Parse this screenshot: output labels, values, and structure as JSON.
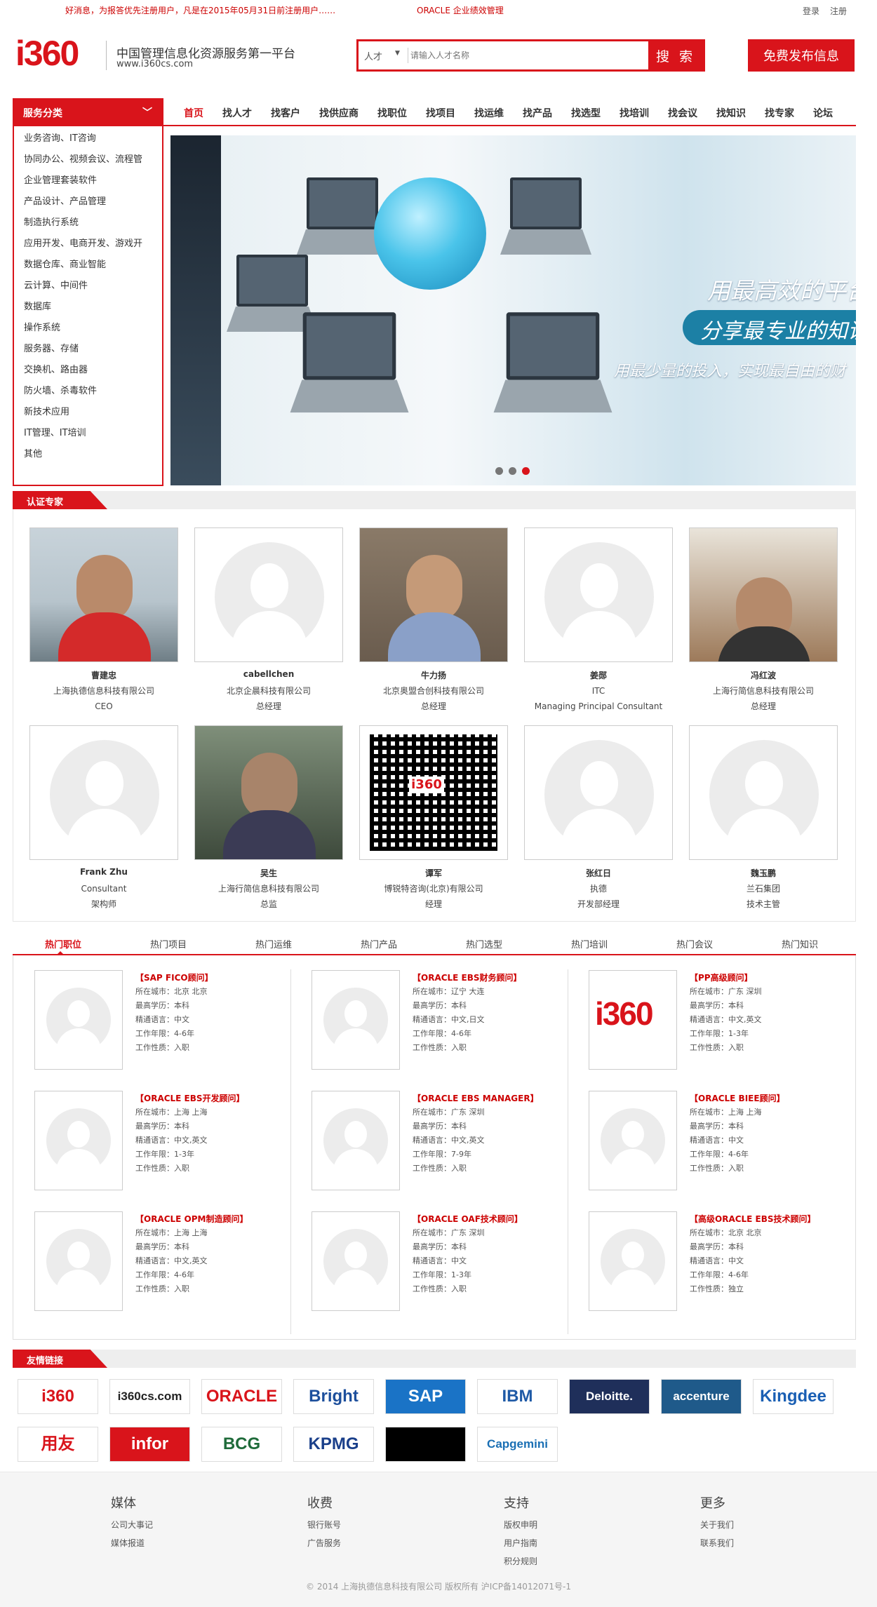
{
  "topbar": {
    "notice": "好消息，为报答优先注册用户，凡是在2015年05月31日前注册用户……",
    "headline": "ORACLE 企业绩效管理",
    "login": "登录",
    "register": "注册"
  },
  "header": {
    "logo": "i360",
    "slogan": "中国管理信息化资源服务第一平台",
    "url": "www.i360cs.com",
    "search": {
      "category": "人才",
      "placeholder": "请输入人才名称",
      "button": "搜 索"
    },
    "publish_button": "免费发布信息"
  },
  "service": {
    "title": "服务分类",
    "items": [
      "业务咨询、IT咨询",
      "协同办公、视频会议、流程管",
      "企业管理套装软件",
      "产品设计、产品管理",
      "制造执行系统",
      "应用开发、电商开发、游戏开",
      "数据仓库、商业智能",
      "云计算、中间件",
      "数据库",
      "操作系统",
      "服务器、存储",
      "交换机、路由器",
      "防火墙、杀毒软件",
      "新技术应用",
      "IT管理、IT培训",
      "其他"
    ]
  },
  "nav": [
    "首页",
    "找人才",
    "找客户",
    "找供应商",
    "找职位",
    "找项目",
    "找运维",
    "找产品",
    "找选型",
    "找培训",
    "找会议",
    "找知识",
    "找专家",
    "论坛"
  ],
  "banner": {
    "line1": "用最高效的平台",
    "line2": "分享最专业的知识",
    "line3": "用最少量的投入，实现最自由的财",
    "active_slide": 3,
    "slide_count": 3
  },
  "experts": {
    "title": "认证专家",
    "items": [
      {
        "name": "曹建忠",
        "company": "上海执德信息科技有限公司",
        "title": "CEO",
        "photo": "real"
      },
      {
        "name": "cabellchen",
        "company": "北京企晨科技有限公司",
        "title": "总经理",
        "photo": "placeholder"
      },
      {
        "name": "牛力扬",
        "company": "北京奥盟合创科技有限公司",
        "title": "总经理",
        "photo": "real"
      },
      {
        "name": "姜郧",
        "company": "ITC",
        "title": "Managing Principal Consultant",
        "photo": "placeholder"
      },
      {
        "name": "冯红波",
        "company": "上海行简信息科技有限公司",
        "title": "总经理",
        "photo": "real"
      },
      {
        "name": "Frank Zhu",
        "company": "Consultant",
        "title": "架构师",
        "photo": "placeholder"
      },
      {
        "name": "吴生",
        "company": "上海行简信息科技有限公司",
        "title": "总监",
        "photo": "real"
      },
      {
        "name": "谭军",
        "company": "博锐特咨询(北京)有限公司",
        "title": "经理",
        "photo": "qr"
      },
      {
        "name": "张红日",
        "company": "执德",
        "title": "开发部经理",
        "photo": "placeholder"
      },
      {
        "name": "魏玉鹏",
        "company": "兰石集团",
        "title": "技术主管",
        "photo": "placeholder"
      }
    ]
  },
  "tabs": [
    "热门职位",
    "热门项目",
    "热门运维",
    "热门产品",
    "热门选型",
    "热门培训",
    "热门会议",
    "热门知识"
  ],
  "job_labels": {
    "city": "所在城市：",
    "education": "最高学历：",
    "language": "精通语言：",
    "years": "工作年限：",
    "nature": "工作性质："
  },
  "jobs": [
    {
      "title": "【SAP FICO顾问】",
      "city": "北京 北京",
      "education": "本科",
      "language": "中文",
      "years": "4-6年",
      "nature": "入职"
    },
    {
      "title": "【ORACLE EBS财务顾问】",
      "city": "辽宁 大连",
      "education": "本科",
      "language": "中文,日文",
      "years": "4-6年",
      "nature": "入职"
    },
    {
      "title": "【PP高级顾问】",
      "city": "广东 深圳",
      "education": "本科",
      "language": "中文,英文",
      "years": "1-3年",
      "nature": "入职",
      "logo": "i360"
    },
    {
      "title": "【ORACLE EBS开发顾问】",
      "city": "上海 上海",
      "education": "本科",
      "language": "中文,英文",
      "years": "1-3年",
      "nature": "入职"
    },
    {
      "title": "【ORACLE EBS MANAGER】",
      "city": "广东 深圳",
      "education": "本科",
      "language": "中文,英文",
      "years": "7-9年",
      "nature": "入职"
    },
    {
      "title": "【ORACLE BIEE顾问】",
      "city": "上海 上海",
      "education": "本科",
      "language": "中文",
      "years": "4-6年",
      "nature": "入职"
    },
    {
      "title": "【ORACLE OPM制造顾问】",
      "city": "上海 上海",
      "education": "本科",
      "language": "中文,英文",
      "years": "4-6年",
      "nature": "入职"
    },
    {
      "title": "【ORACLE OAF技术顾问】",
      "city": "广东 深圳",
      "education": "本科",
      "language": "中文",
      "years": "1-3年",
      "nature": "入职"
    },
    {
      "title": "【高级ORACLE EBS技术顾问】",
      "city": "北京 北京",
      "education": "本科",
      "language": "中文",
      "years": "4-6年",
      "nature": "独立"
    }
  ],
  "links": {
    "title": "友情链接",
    "logos": [
      {
        "text": "i360",
        "color": "#d9141b",
        "bg": "#ffffff"
      },
      {
        "text": "i360cs.com",
        "color": "#222222",
        "bg": "#ffffff"
      },
      {
        "text": "ORACLE",
        "color": "#d9141b",
        "bg": "#ffffff"
      },
      {
        "text": "Bright",
        "color": "#1d4f9c",
        "bg": "#ffffff"
      },
      {
        "text": "SAP",
        "color": "#ffffff",
        "bg": "#1a73c6"
      },
      {
        "text": "IBM",
        "color": "#1f5aa6",
        "bg": "#ffffff"
      },
      {
        "text": "Deloitte.",
        "color": "#ffffff",
        "bg": "#1f2f5a"
      },
      {
        "text": "accenture",
        "color": "#ffffff",
        "bg": "#1f5a8a"
      },
      {
        "text": "Kingdee",
        "color": "#1a5fb4",
        "bg": "#ffffff"
      },
      {
        "text": "用友",
        "color": "#d9141b",
        "bg": "#ffffff"
      },
      {
        "text": "infor",
        "color": "#ffffff",
        "bg": "#d9141b"
      },
      {
        "text": "BCG",
        "color": "#1f6b3a",
        "bg": "#ffffff"
      },
      {
        "text": "KPMG",
        "color": "#1a3f8a",
        "bg": "#ffffff"
      },
      {
        "text": "",
        "color": "#ffffff",
        "bg": "#000000"
      },
      {
        "text": "Capgemini",
        "color": "#1a6fb4",
        "bg": "#ffffff"
      }
    ]
  },
  "footer": {
    "columns": [
      {
        "head": "媒体",
        "links": [
          "公司大事记",
          "媒体报道"
        ]
      },
      {
        "head": "收费",
        "links": [
          "银行账号",
          "广告服务"
        ]
      },
      {
        "head": "支持",
        "links": [
          "版权申明",
          "用户指南",
          "积分规则"
        ]
      },
      {
        "head": "更多",
        "links": [
          "关于我们",
          "联系我们"
        ]
      }
    ],
    "copyright": "© 2014 上海执德信息科技有限公司 版权所有    沪ICP备14012071号-1"
  },
  "colors": {
    "brand": "#d9141b"
  }
}
